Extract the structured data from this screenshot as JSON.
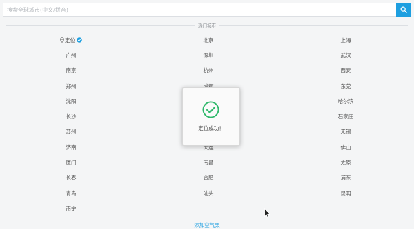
{
  "search": {
    "placeholder": "搜索全球城市(中文/拼音)",
    "value": ""
  },
  "section": {
    "hot_cities_label": "热门城市"
  },
  "location_city": {
    "label": "定位",
    "icon": "location-pin-icon",
    "status": "located"
  },
  "cities": [
    "北京",
    "上海",
    "广州",
    "深圳",
    "武汉",
    "南京",
    "杭州",
    "西安",
    "郑州",
    "成都",
    "东莞",
    "沈阳",
    "",
    "哈尔滨",
    "长沙",
    "",
    "石家庄",
    "苏州",
    "",
    "无锡",
    "济南",
    "大连",
    "佛山",
    "厦门",
    "南昌",
    "太原",
    "长春",
    "合肥",
    "浦东",
    "青岛",
    "汕头",
    "昆明",
    "南宁"
  ],
  "toast": {
    "message": "定位成功！",
    "icon": "success-check-circle-icon"
  },
  "bottom": {
    "add_label": "添加空气果"
  },
  "colors": {
    "accent": "#1e9fe0",
    "success": "#2fb86b",
    "background": "#f4f5f6"
  }
}
